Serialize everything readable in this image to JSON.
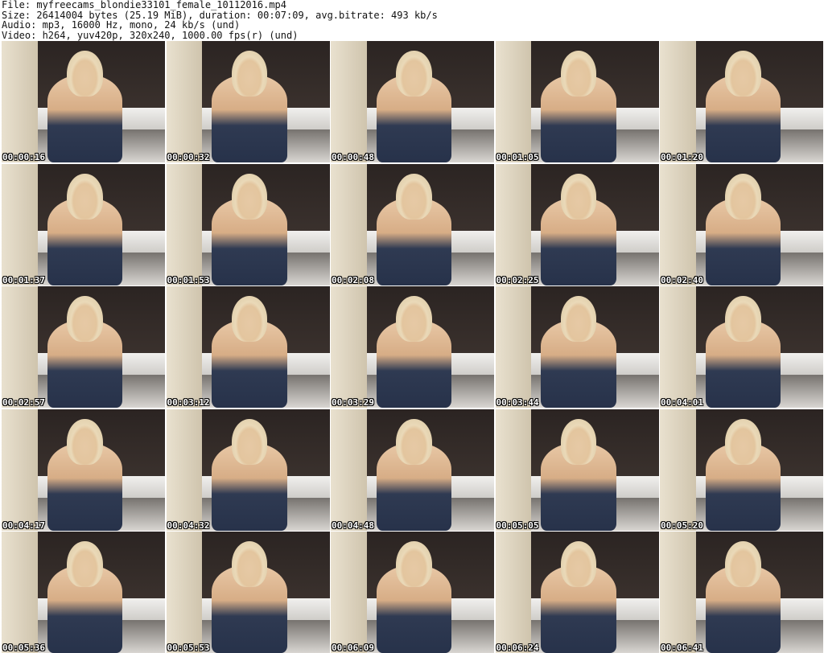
{
  "header": {
    "file_line": "File: myfreecams_blondie33101_female_10112016.mp4",
    "size_line": "Size: 26414004 bytes (25.19 MiB), duration: 00:07:09, avg.bitrate: 493 kb/s",
    "audio_line": "Audio: mp3, 16000 Hz, mono, 24 kb/s (und)",
    "video_line": "Video: h264, yuv420p, 320x240, 1000.00 fps(r) (und)"
  },
  "thumbnails": [
    {
      "timestamp": "00:00:16"
    },
    {
      "timestamp": "00:00:32"
    },
    {
      "timestamp": "00:00:48"
    },
    {
      "timestamp": "00:01:05"
    },
    {
      "timestamp": "00:01:20"
    },
    {
      "timestamp": "00:01:37"
    },
    {
      "timestamp": "00:01:53"
    },
    {
      "timestamp": "00:02:08"
    },
    {
      "timestamp": "00:02:25"
    },
    {
      "timestamp": "00:02:40"
    },
    {
      "timestamp": "00:02:57"
    },
    {
      "timestamp": "00:03:12"
    },
    {
      "timestamp": "00:03:29"
    },
    {
      "timestamp": "00:03:44"
    },
    {
      "timestamp": "00:04:01"
    },
    {
      "timestamp": "00:04:17"
    },
    {
      "timestamp": "00:04:32"
    },
    {
      "timestamp": "00:04:48"
    },
    {
      "timestamp": "00:05:05"
    },
    {
      "timestamp": "00:05:20"
    },
    {
      "timestamp": "00:05:36"
    },
    {
      "timestamp": "00:05:53"
    },
    {
      "timestamp": "00:06:09"
    },
    {
      "timestamp": "00:06:24"
    },
    {
      "timestamp": "00:06:41"
    }
  ]
}
